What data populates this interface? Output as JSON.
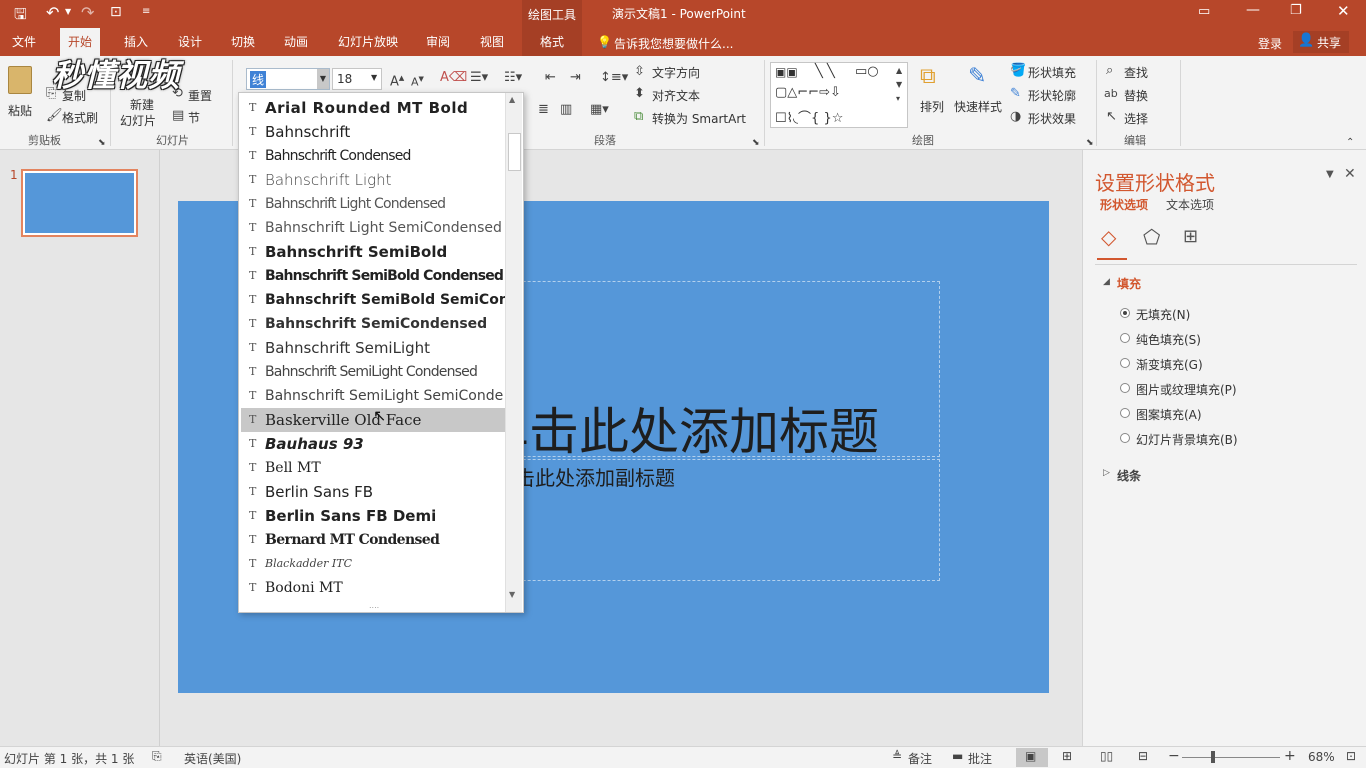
{
  "titlebar": {
    "context_tab": "绘图工具",
    "title": "演示文稿1 - PowerPoint",
    "watermark": "秒懂视频"
  },
  "tabs": {
    "items": [
      {
        "label": "文件"
      },
      {
        "label": "开始"
      },
      {
        "label": "插入"
      },
      {
        "label": "设计"
      },
      {
        "label": "切换"
      },
      {
        "label": "动画"
      },
      {
        "label": "幻灯片放映"
      },
      {
        "label": "审阅"
      },
      {
        "label": "视图"
      },
      {
        "label": "格式"
      }
    ],
    "tell_me": "告诉我您想要做什么...",
    "login": "登录",
    "share": "共享"
  },
  "ribbon": {
    "clipboard": {
      "paste": "粘贴",
      "copy": "复制",
      "format_painter": "格式刷",
      "label": "剪贴板"
    },
    "slides": {
      "new_slide_1": "新建",
      "new_slide_2": "幻灯片",
      "reset": "重置",
      "section": "节",
      "label": "幻灯片"
    },
    "font": {
      "name_value": "线",
      "size_value": "18"
    },
    "paragraph": {
      "text_direction": "文字方向",
      "align_text": "对齐文本",
      "smartart": "转换为 SmartArt",
      "label": "段落"
    },
    "drawing": {
      "arrange": "排列",
      "quick_styles": "快速样式",
      "shape_fill": "形状填充",
      "shape_outline": "形状轮廓",
      "shape_effects": "形状效果",
      "label": "绘图"
    },
    "editing": {
      "find": "查找",
      "replace": "替换",
      "select": "选择",
      "label": "编辑"
    }
  },
  "thumbnail": {
    "number": "1"
  },
  "slide": {
    "title_placeholder": "单击此处添加标题",
    "subtitle_placeholder": "单击此处添加副标题"
  },
  "font_dropdown": {
    "items": [
      {
        "name": "Arial Rounded MT Bold"
      },
      {
        "name": "Bahnschrift"
      },
      {
        "name": "Bahnschrift Condensed"
      },
      {
        "name": "Bahnschrift Light"
      },
      {
        "name": "Bahnschrift Light Condensed"
      },
      {
        "name": "Bahnschrift Light SemiCondensed"
      },
      {
        "name": "Bahnschrift SemiBold"
      },
      {
        "name": "Bahnschrift SemiBold Condensed"
      },
      {
        "name": "Bahnschrift SemiBold SemiConden"
      },
      {
        "name": "Bahnschrift SemiCondensed"
      },
      {
        "name": "Bahnschrift SemiLight"
      },
      {
        "name": "Bahnschrift SemiLight Condensed"
      },
      {
        "name": "Bahnschrift SemiLight SemiConde"
      },
      {
        "name": "Baskerville Old Face"
      },
      {
        "name": "Bauhaus 93"
      },
      {
        "name": "Bell MT"
      },
      {
        "name": "Berlin Sans FB"
      },
      {
        "name": "Berlin Sans FB Demi"
      },
      {
        "name": "Bernard MT Condensed"
      },
      {
        "name": "Blackadder ITC"
      },
      {
        "name": "Bodoni MT"
      }
    ],
    "highlighted_index": 13,
    "tt_glyph": "T"
  },
  "format_pane": {
    "title": "设置形状格式",
    "tab_shape": "形状选项",
    "tab_text": "文本选项",
    "fill_section": "填充",
    "fill_options": [
      {
        "label": "无填充(N)",
        "selected": true
      },
      {
        "label": "纯色填充(S)",
        "selected": false
      },
      {
        "label": "渐变填充(G)",
        "selected": false
      },
      {
        "label": "图片或纹理填充(P)",
        "selected": false
      },
      {
        "label": "图案填充(A)",
        "selected": false
      },
      {
        "label": "幻灯片背景填充(B)",
        "selected": false
      }
    ],
    "line_section": "线条"
  },
  "statusbar": {
    "slide_info": "幻灯片 第 1 张，共 1 张",
    "language": "英语(美国)",
    "notes": "备注",
    "comments": "批注",
    "zoom": "68%"
  },
  "colors": {
    "accent": "#b7472a",
    "slide_bg": "#5597d9"
  }
}
